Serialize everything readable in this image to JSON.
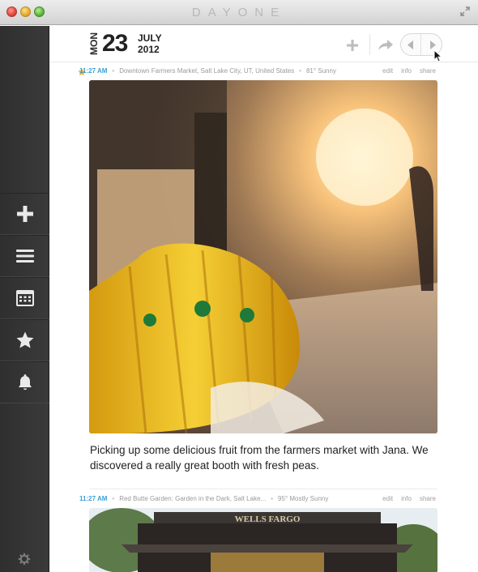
{
  "window": {
    "title": "DAYONE"
  },
  "sidebar": {
    "items": [
      {
        "name": "new-entry",
        "icon": "plus-icon"
      },
      {
        "name": "list",
        "icon": "list-icon"
      },
      {
        "name": "calendar",
        "icon": "calendar-icon"
      },
      {
        "name": "starred",
        "icon": "star-icon"
      },
      {
        "name": "reminders",
        "icon": "bell-icon"
      }
    ],
    "settings_icon": "gear-icon"
  },
  "header": {
    "weekday": "MON",
    "day": "23",
    "month": "JULY",
    "year": "2012"
  },
  "entries": [
    {
      "starred": true,
      "time": "11:27 AM",
      "location": "Downtown Farmers Market, Salt Lake City, UT, United States",
      "weather": "81° Sunny",
      "actions": [
        "edit",
        "info",
        "share"
      ],
      "text": "Picking up some delicious fruit from the farmers market with Jana. We discovered a really great booth with fresh peas."
    },
    {
      "starred": false,
      "time": "11:27 AM",
      "location": "Red Butte Garden: Garden in the Dark, Salt Lake...",
      "weather": "95° Mostly Sunny",
      "actions": [
        "edit",
        "info",
        "share"
      ],
      "photo_sign_text": "WELLS FARGO"
    }
  ],
  "colors": {
    "accent_time": "#3aa0d4",
    "star": "#f2a81d",
    "sidebar": "#333333"
  }
}
